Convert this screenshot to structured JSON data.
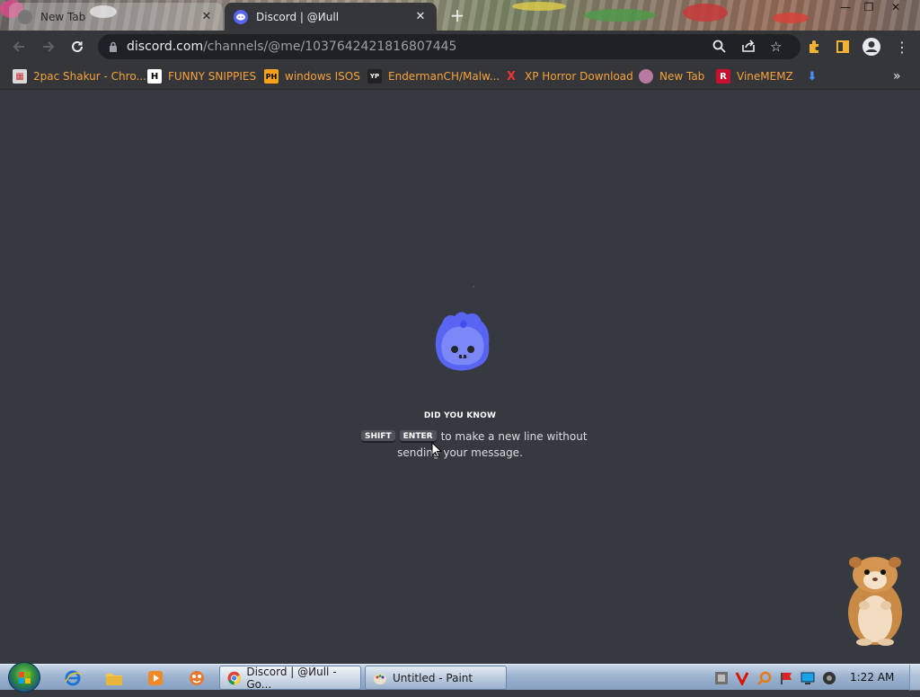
{
  "browser": {
    "tabs": [
      {
        "title": "New Tab",
        "active": false
      },
      {
        "title": "Discord | @Иull",
        "active": true
      }
    ],
    "url": {
      "host": "discord.com",
      "path": "/channels/@me/1037642421816807445"
    },
    "bookmarks": [
      {
        "label": "2pac Shakur - Chro...",
        "icon": "gift-icon"
      },
      {
        "label": "FUNNY SNIPPIES",
        "icon": "h-logo-icon",
        "icon_text": "H"
      },
      {
        "label": "windows ISOS",
        "icon": "ph-logo-icon",
        "icon_text": "PH"
      },
      {
        "label": "EndermanCH/Malw...",
        "icon": "yp-logo-icon",
        "icon_text": "YP"
      },
      {
        "label": "XP Horror Download",
        "icon": "x-logo-icon",
        "icon_text": "X"
      },
      {
        "label": "New Tab",
        "icon": "globe-icon"
      },
      {
        "label": "VineMEMZ",
        "icon": "r-logo-icon",
        "icon_text": "R"
      }
    ],
    "overflow_label": "»"
  },
  "main": {
    "tip_title": "DID YOU KNOW",
    "keys": [
      "SHIFT",
      "ENTER"
    ],
    "tip_text_1": "to make a new line without",
    "tip_text_2": "sending your message."
  },
  "taskbar": {
    "tasks": [
      {
        "label": "Discord | @Иull - Go...",
        "active": true
      },
      {
        "label": "Untitled - Paint",
        "active": false
      }
    ],
    "clock": "1:22 AM"
  },
  "colors": {
    "accent": "#5865f2",
    "background": "#36393f",
    "bookmark_text": "#f6a23c"
  }
}
